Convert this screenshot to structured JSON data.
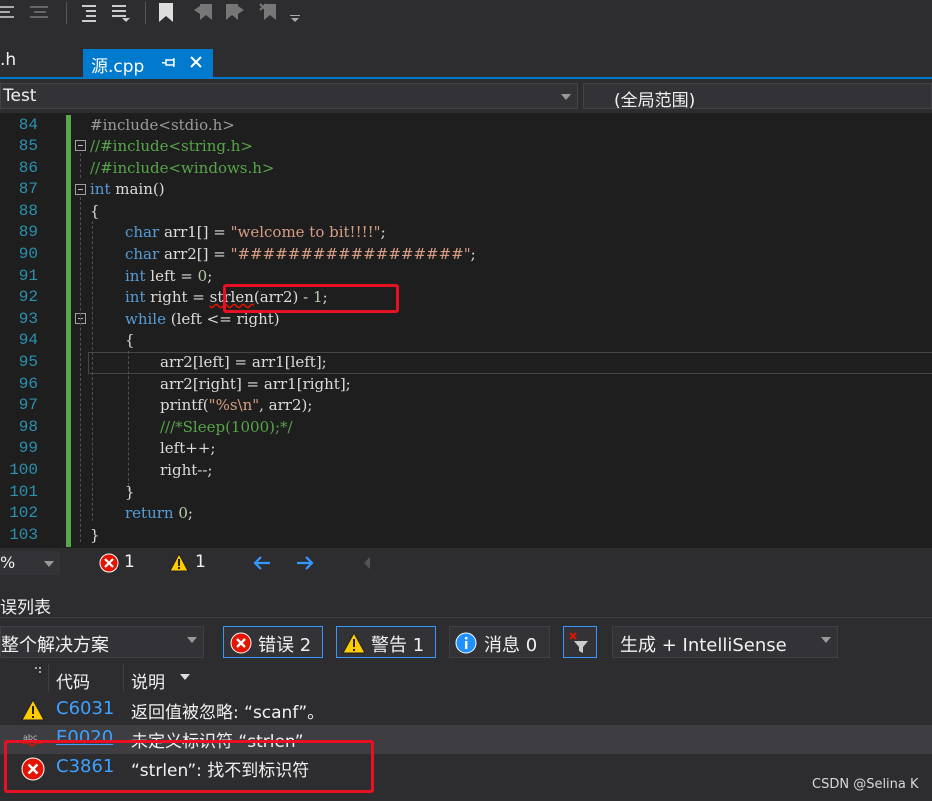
{
  "tabs": {
    "prev_tab_label": ".h",
    "active_tab_label": "源.cpp"
  },
  "navbar": {
    "project_combo": "Test",
    "scope_combo": "(全局范围)"
  },
  "editor": {
    "lines": [
      {
        "num": "84"
      },
      {
        "num": "85"
      },
      {
        "num": "86"
      },
      {
        "num": "87"
      },
      {
        "num": "88"
      },
      {
        "num": "89"
      },
      {
        "num": "90"
      },
      {
        "num": "91"
      },
      {
        "num": "92"
      },
      {
        "num": "93"
      },
      {
        "num": "94"
      },
      {
        "num": "95"
      },
      {
        "num": "96"
      },
      {
        "num": "97"
      },
      {
        "num": "98"
      },
      {
        "num": "99"
      },
      {
        "num": "100"
      },
      {
        "num": "101"
      },
      {
        "num": "102"
      },
      {
        "num": "103"
      }
    ],
    "code": {
      "l84_pre": "#include",
      "l84_rest": "<stdio.h>",
      "l85": "//#include<string.h>",
      "l86": "//#include<windows.h>",
      "l87_kw": "int",
      "l87_rest": " main()",
      "l88": "{",
      "l89_kw": "char",
      "l89_mid": " arr1[] = ",
      "l89_str": "\"welcome to bit!!!!\"",
      "l89_end": ";",
      "l90_kw": "char",
      "l90_mid": " arr2[] = ",
      "l90_str": "\"##################\"",
      "l90_end": ";",
      "l91_kw": "int",
      "l91_mid": " left = ",
      "l91_num": "0",
      "l91_end": ";",
      "l92_kw": "int",
      "l92_mid": " right = ",
      "l92_fn": "strlen",
      "l92_rest": "(arr2) - ",
      "l92_num": "1",
      "l92_end": ";",
      "l93_kw": "while",
      "l93_rest": " (left <= right)",
      "l94": "{",
      "l95": "arr2[left] = arr1[left];",
      "l96": "arr2[right] = arr1[right];",
      "l97_fn": "printf(",
      "l97_str": "\"%s\\n\"",
      "l97_rest": ", arr2);",
      "l98": "///*Sleep(1000);*/",
      "l99": "left++;",
      "l100": "right--;",
      "l101": "}",
      "l102_kw": "return",
      "l102_sp": " ",
      "l102_num": "0",
      "l102_end": ";",
      "l103": "}"
    }
  },
  "status": {
    "zoom": "%",
    "error_count": "1",
    "warning_count": "1"
  },
  "error_list": {
    "title": "误列表",
    "scope": "整个解决方案",
    "errors_btn": "错误 2",
    "warnings_btn": "警告 1",
    "messages_btn": "消息 0",
    "build_filter": "生成 + IntelliSense",
    "col_code": "代码",
    "col_desc": "说明",
    "rows": [
      {
        "type": "warning",
        "code": "C6031",
        "desc": "返回值被忽略: “scanf”。"
      },
      {
        "type": "intellisense",
        "code": "E0020",
        "desc": "未定义标识符 “strlen”"
      },
      {
        "type": "error",
        "code": "C3861",
        "desc": "“strlen”: 找不到标识符"
      }
    ]
  },
  "watermark": "CSDN @Selina K",
  "colors": {
    "accent": "#007acc",
    "highlight_box": "#e81123",
    "keyword": "#569cd6",
    "comment": "#57a64a",
    "string": "#d69d85",
    "line_number": "#2b91af",
    "link": "#3ea1ff"
  }
}
